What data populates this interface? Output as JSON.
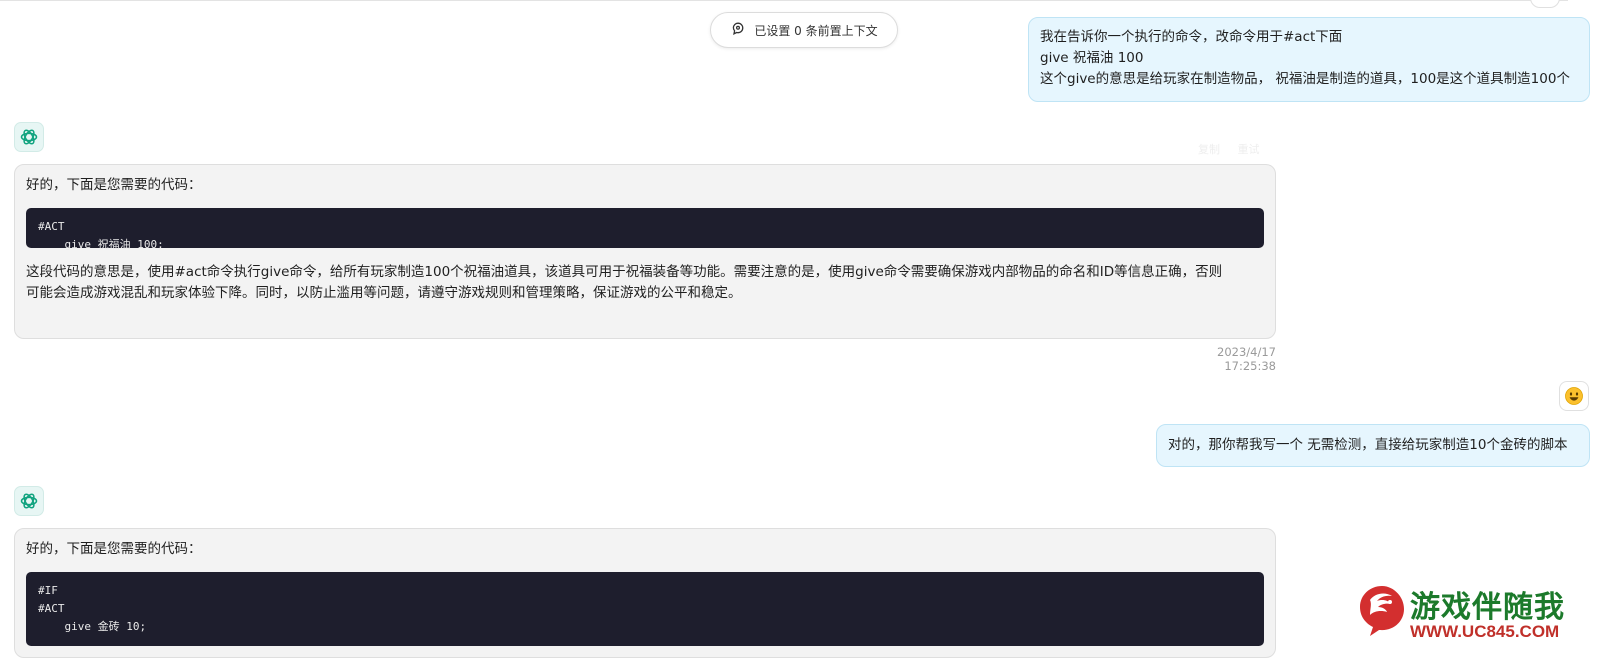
{
  "context_pill": {
    "label": "已设置 0 条前置上下文",
    "icon": "context-icon"
  },
  "messages": [
    {
      "role": "user",
      "lines": [
        "我在告诉你一个执行的命令，改命令用于#act下面",
        "give 祝福油 100",
        "这个give的意思是给玩家在制造物品， 祝福油是制造的道具，100是这个道具制造100个"
      ]
    },
    {
      "role": "assistant",
      "intro": "好的，下面是您需要的代码：",
      "code_lines": [
        "#ACT",
        "    give 祝福油 100;"
      ],
      "para_lines": [
        "这段代码的意思是，使用#act命令执行give命令，给所有玩家制造100个祝福油道具，该道具可用于祝福装备等功能。需要注意的是，使用give命令需要确保游戏内部物品的命名和ID等信息正确，否则",
        "可能会造成游戏混乱和玩家体验下降。同时，以防止滥用等问题，请遵守游戏规则和管理策略，保证游戏的公平和稳定。"
      ],
      "timestamp": "2023/4/17 17:25:38",
      "actions": [
        "复制",
        "重试"
      ]
    },
    {
      "role": "user",
      "lines": [
        "对的，那你帮我写一个 无需检测，直接给玩家制造10个金砖的脚本"
      ]
    },
    {
      "role": "assistant",
      "intro": "好的，下面是您需要的代码：",
      "code_lines": [
        "#IF",
        "#ACT",
        "    give 金砖 10;"
      ]
    }
  ],
  "watermark": {
    "title": "游戏伴随我",
    "url": "WWW.UC845.COM"
  },
  "colors": {
    "user_bubble_bg": "#e6f6fe",
    "bot_bubble_bg": "#f3f3f3",
    "code_bg": "#1e1e2d",
    "bot_icon": "#10a37f"
  }
}
